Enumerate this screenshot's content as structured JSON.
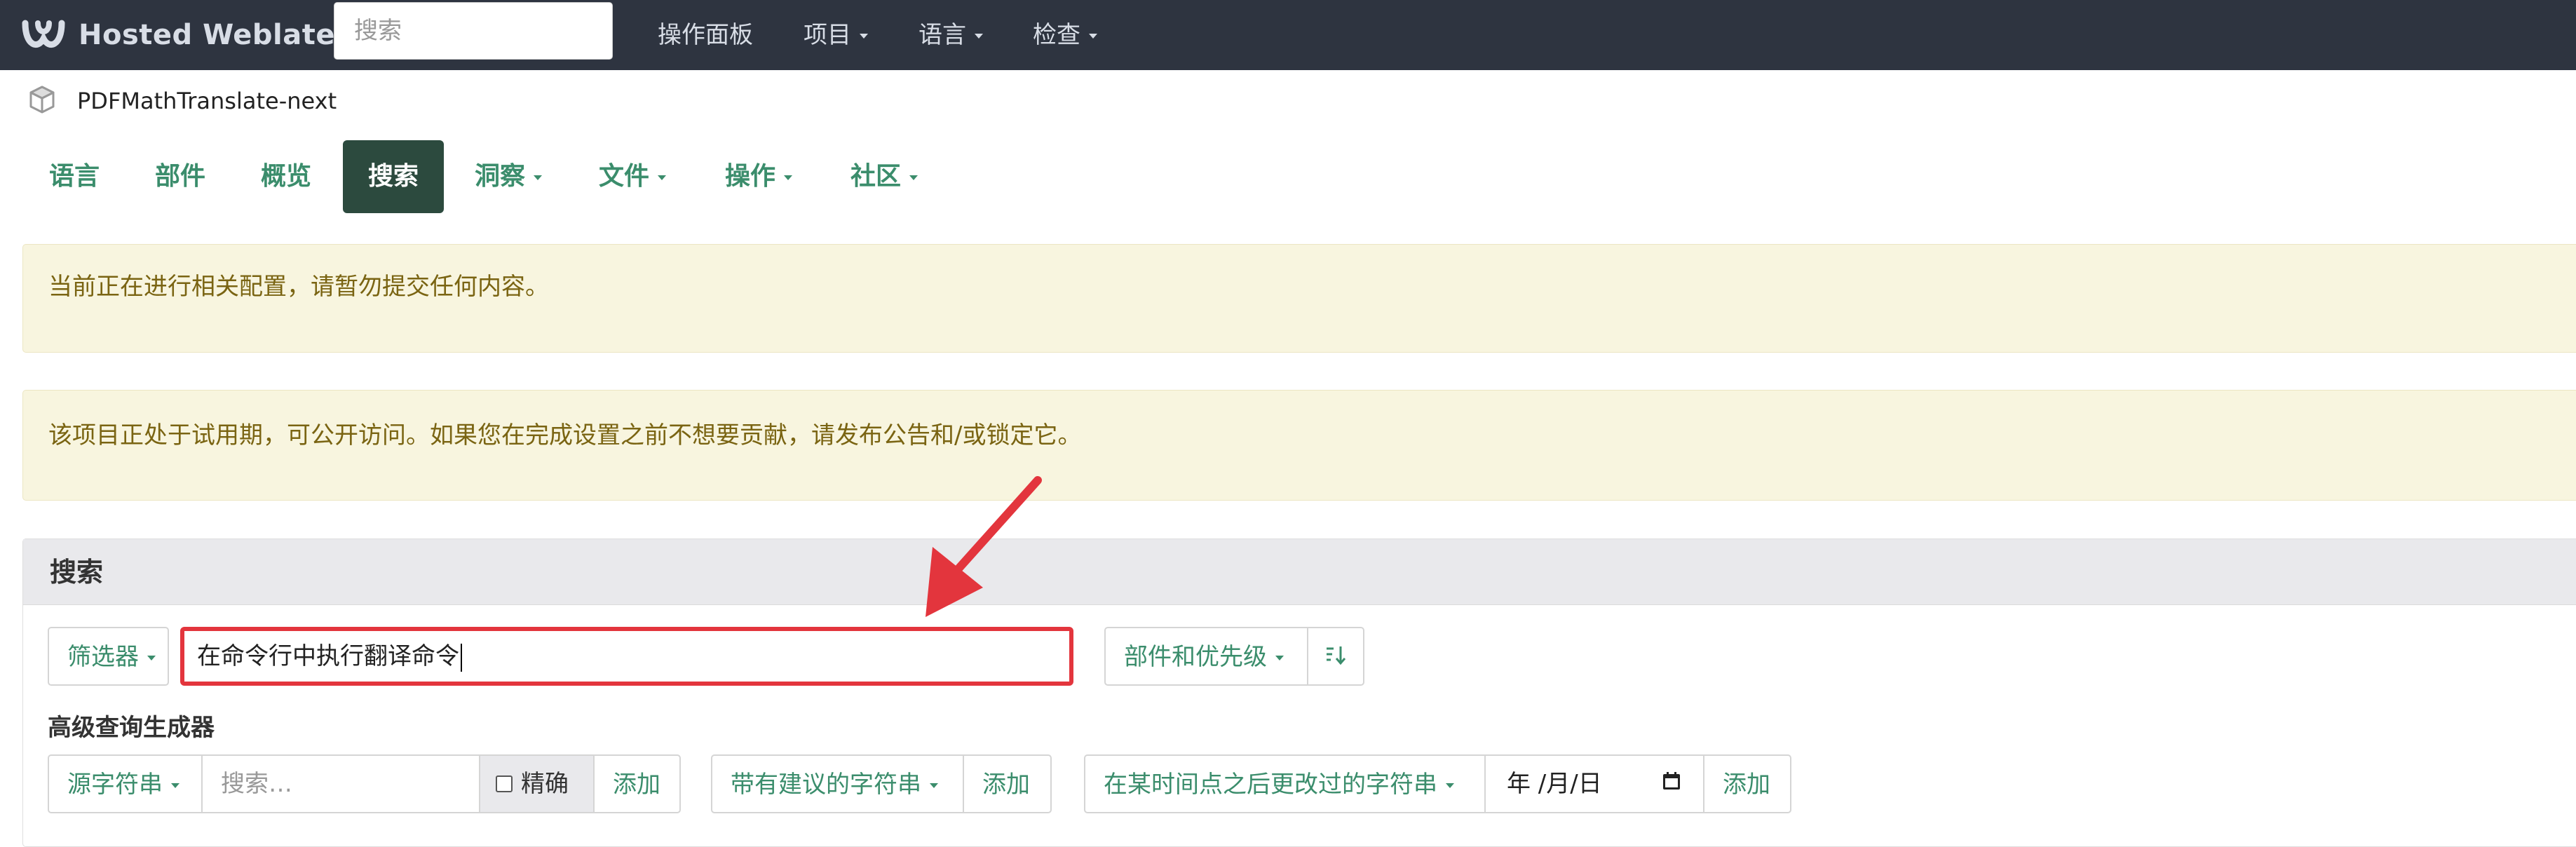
{
  "navbar": {
    "brand": "Hosted Weblate",
    "search_placeholder": "搜索",
    "items": [
      {
        "label": "操作面板",
        "dropdown": false
      },
      {
        "label": "项目",
        "dropdown": true
      },
      {
        "label": "语言",
        "dropdown": true
      },
      {
        "label": "检查",
        "dropdown": true
      }
    ]
  },
  "breadcrumb": {
    "project": "PDFMathTranslate-next"
  },
  "tabs": [
    {
      "label": "语言",
      "active": false
    },
    {
      "label": "部件",
      "active": false
    },
    {
      "label": "概览",
      "active": false
    },
    {
      "label": "搜索",
      "active": true
    },
    {
      "label": "洞察",
      "active": false
    },
    {
      "label": "文件",
      "active": false
    },
    {
      "label": "操作",
      "active": false
    },
    {
      "label": "社区",
      "active": false
    }
  ],
  "alerts": [
    "当前正在进行相关配置，请暂勿提交任何内容。",
    "该项目正处于试用期，可公开访问。如果您在完成设置之前不想要贡献，请发布公告和/或锁定它。"
  ],
  "search_panel": {
    "heading": "搜索",
    "filter_label": "筛选器",
    "query_value": "在命令行中执行翻译命令",
    "sort_label": "部件和优先级",
    "builder_label": "高级查询生成器",
    "source_label": "源字符串",
    "source_placeholder": "搜索…",
    "exact_label": "精确",
    "add_label": "添加",
    "suggestion_label": "带有建议的字符串",
    "changed_label": "在某时间点之后更改过的字符串",
    "date_placeholder": "年 /月/日"
  },
  "colors": {
    "navbar_bg": "#2e3440",
    "accent_green": "#3b8d6c",
    "active_tab": "#2c4a3e",
    "alert_bg": "#f8f5df",
    "highlight_red": "#e3353d"
  }
}
